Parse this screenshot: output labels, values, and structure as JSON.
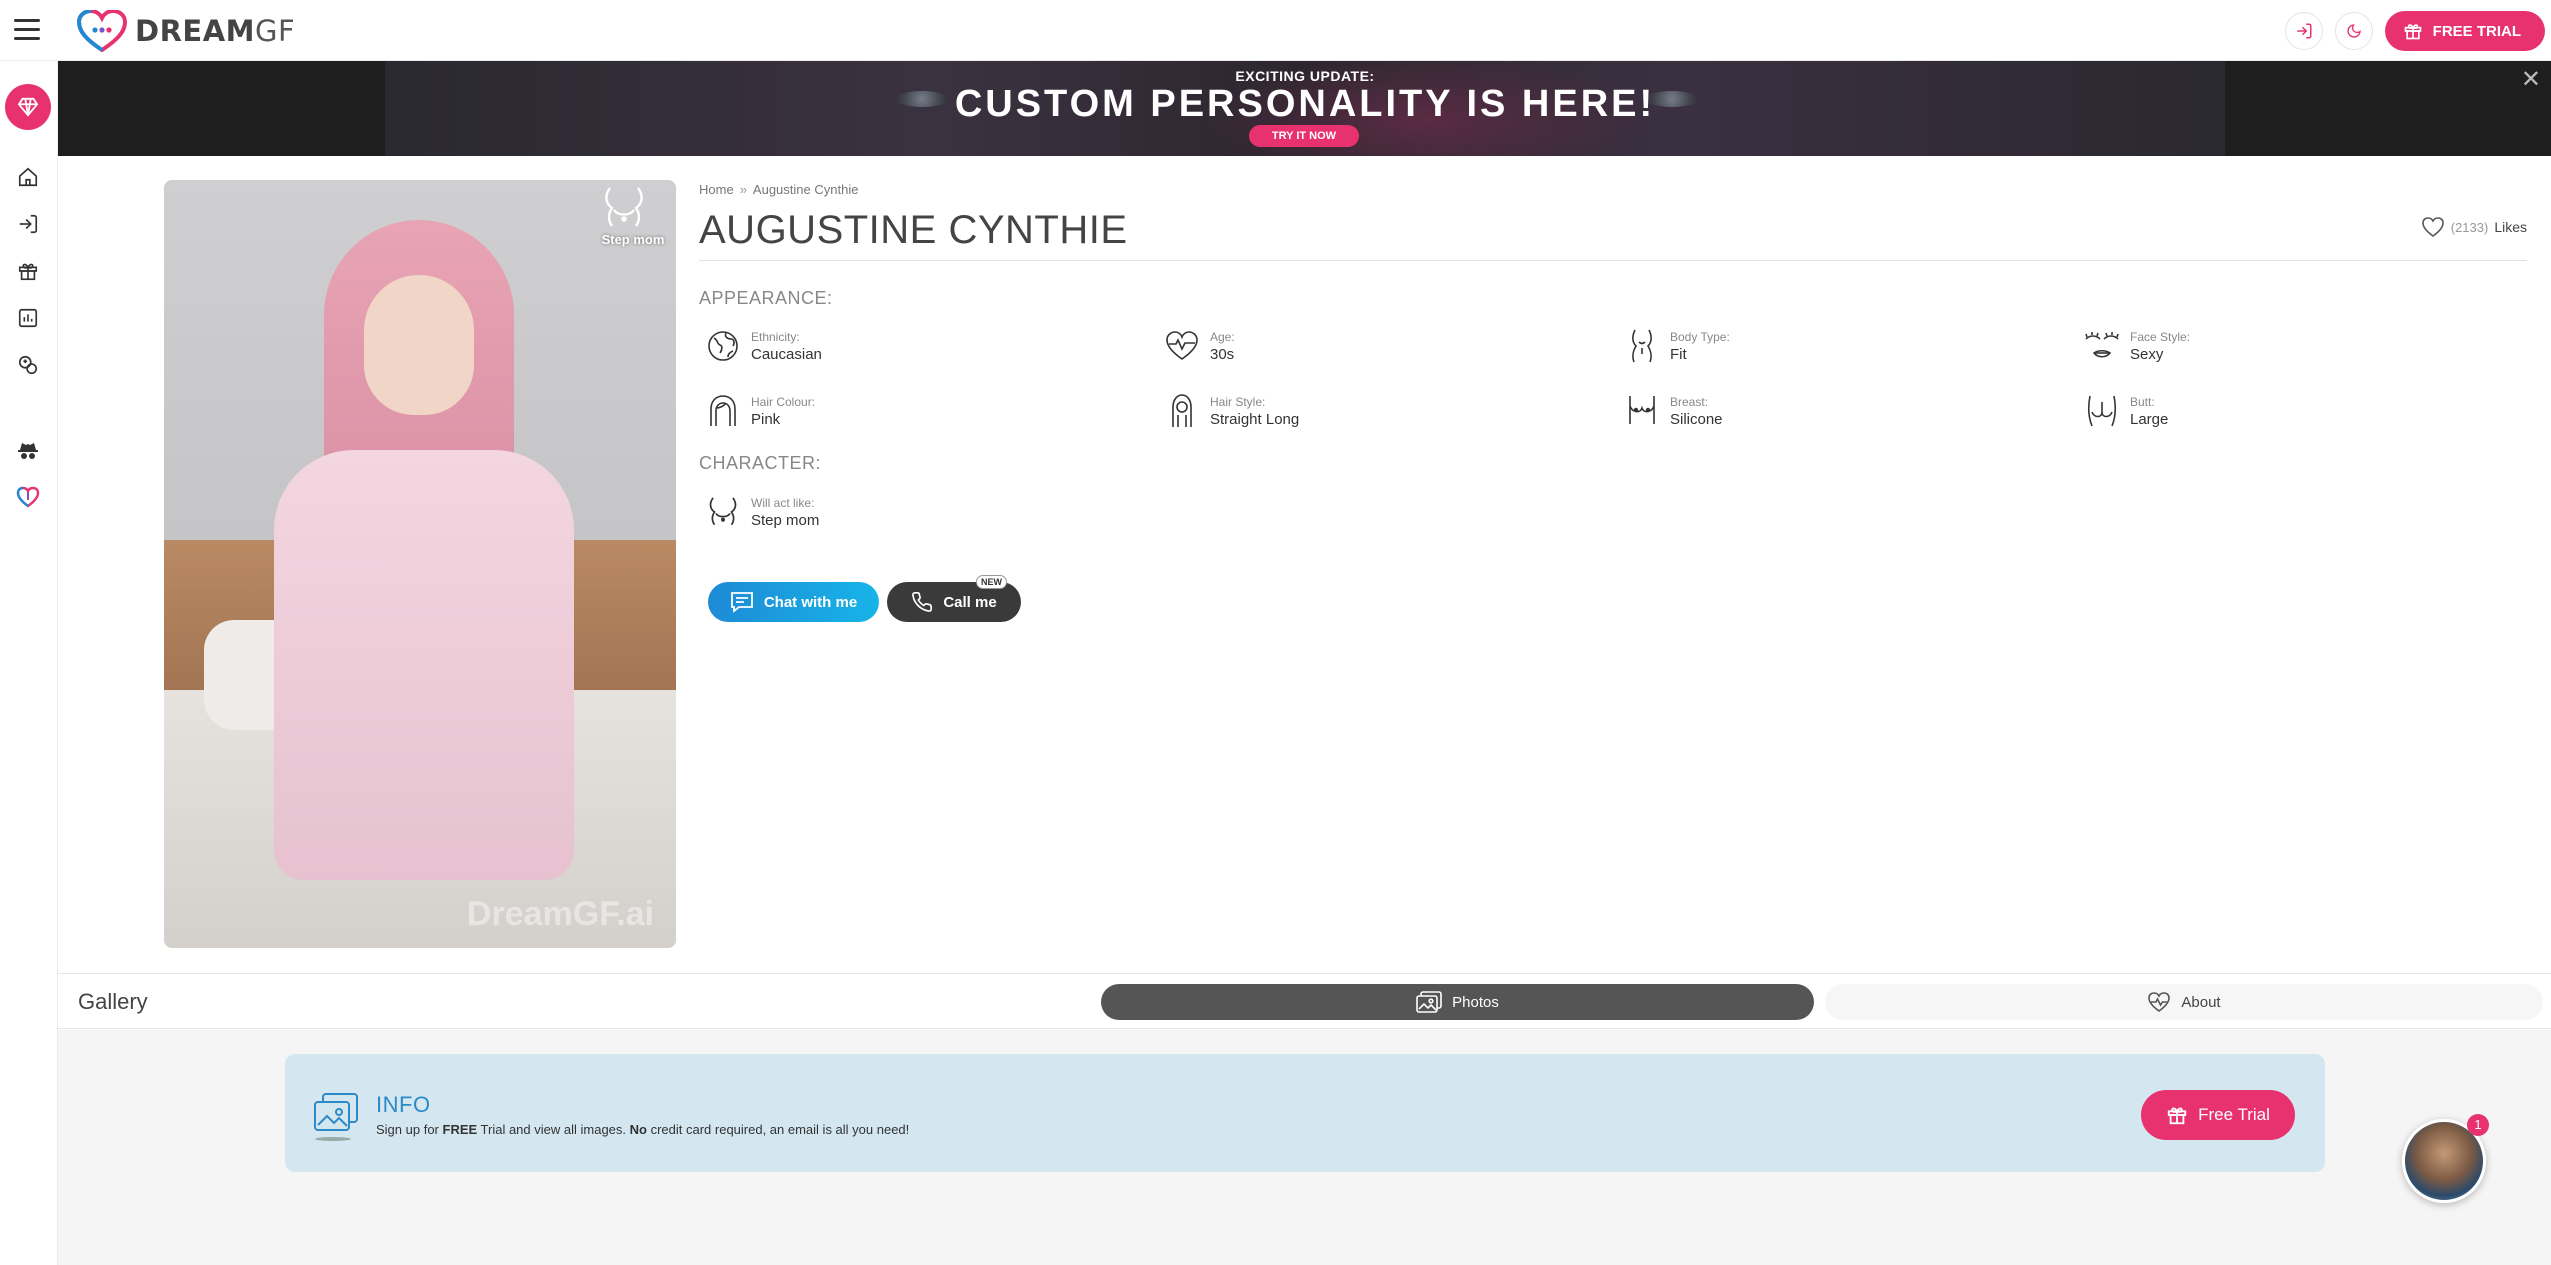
{
  "header": {
    "logo_text_bold": "DREAM",
    "logo_text_light": "GF",
    "free_trial_label": "FREE TRIAL"
  },
  "colors": {
    "brand_pink": "#e8326f",
    "brand_blue": "#1e8ad6",
    "info_blue": "#2c8ac8"
  },
  "sidebar": {
    "items": [
      {
        "icon": "diamond-icon"
      },
      {
        "icon": "home-icon"
      },
      {
        "icon": "login-icon"
      },
      {
        "icon": "gift-icon"
      },
      {
        "icon": "chart-icon"
      },
      {
        "icon": "generator-icon"
      },
      {
        "icon": "anonymous-icon"
      },
      {
        "icon": "heart-icon"
      }
    ]
  },
  "banner": {
    "subtitle": "EXCITING UPDATE:",
    "title": "CUSTOM PERSONALITY IS HERE!",
    "button_label": "TRY IT NOW",
    "close_label": "✕"
  },
  "profile": {
    "watermark": "DreamGF.ai",
    "role_badge": "Step mom",
    "breadcrumb": [
      "Home",
      "Augustine Cynthie"
    ],
    "breadcrumb_sep": "»",
    "name": "AUGUSTINE CYNTHIE",
    "likes_count": "(2133)",
    "likes_label": "Likes"
  },
  "appearance": {
    "heading": "APPEARANCE:",
    "items": [
      {
        "label": "Ethnicity:",
        "value": "Caucasian",
        "icon": "globe-icon"
      },
      {
        "label": "Age:",
        "value": "30s",
        "icon": "heartbeat-icon"
      },
      {
        "label": "Body Type:",
        "value": "Fit",
        "icon": "body-icon"
      },
      {
        "label": "Face Style:",
        "value": "Sexy",
        "icon": "face-icon"
      },
      {
        "label": "Hair Colour:",
        "value": "Pink",
        "icon": "hair-icon"
      },
      {
        "label": "Hair Style:",
        "value": "Straight Long",
        "icon": "hairstyle-icon"
      },
      {
        "label": "Breast:",
        "value": "Silicone",
        "icon": "breast-icon"
      },
      {
        "label": "Butt:",
        "value": "Large",
        "icon": "butt-icon"
      }
    ]
  },
  "character": {
    "heading": "CHARACTER:",
    "items": [
      {
        "label": "Will act like:",
        "value": "Step mom",
        "icon": "stepmom-icon"
      }
    ]
  },
  "actions": {
    "chat_label": "Chat with me",
    "call_label": "Call me",
    "new_tag": "NEW"
  },
  "gallery": {
    "title": "Gallery",
    "tabs": [
      {
        "label": "Photos",
        "active": true
      },
      {
        "label": "About",
        "active": false
      }
    ]
  },
  "info": {
    "title": "INFO",
    "text_parts": [
      "Sign up for ",
      "FREE",
      " Trial and view all images. ",
      "No",
      " credit card required, an email is all you need!"
    ],
    "button_label": "Free Trial"
  },
  "chat_widget": {
    "badge": "1"
  }
}
